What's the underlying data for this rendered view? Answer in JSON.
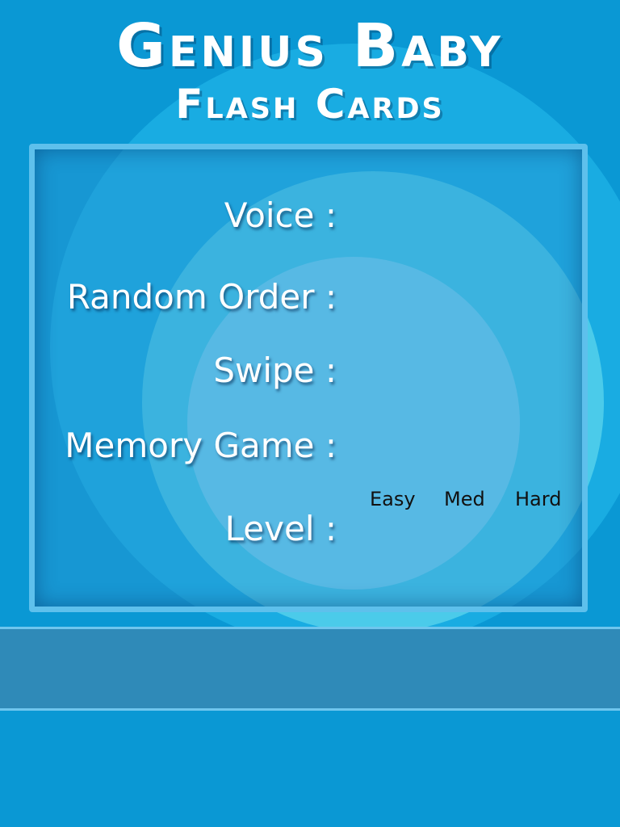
{
  "app": {
    "title_line1": "Genius Baby",
    "title_line2": "Flash Cards"
  },
  "settings": {
    "voice_label": "Voice :",
    "random_order_label": "Random Order :",
    "swipe_label": "Swipe :",
    "memory_game_label": "Memory Game :",
    "level_label": "Level :",
    "level_options": [
      "Easy",
      "Med",
      "Hard"
    ]
  },
  "colors": {
    "background": "#0a98d4",
    "ring_outer": "#19ace2",
    "ring_middle": "#4bcbea",
    "ring_inner": "#7ed6f2",
    "panel_border": "#5ec0ec",
    "footer_band": "#2f8ab8",
    "title_text": "#ffffff",
    "option_text": "#111111"
  }
}
